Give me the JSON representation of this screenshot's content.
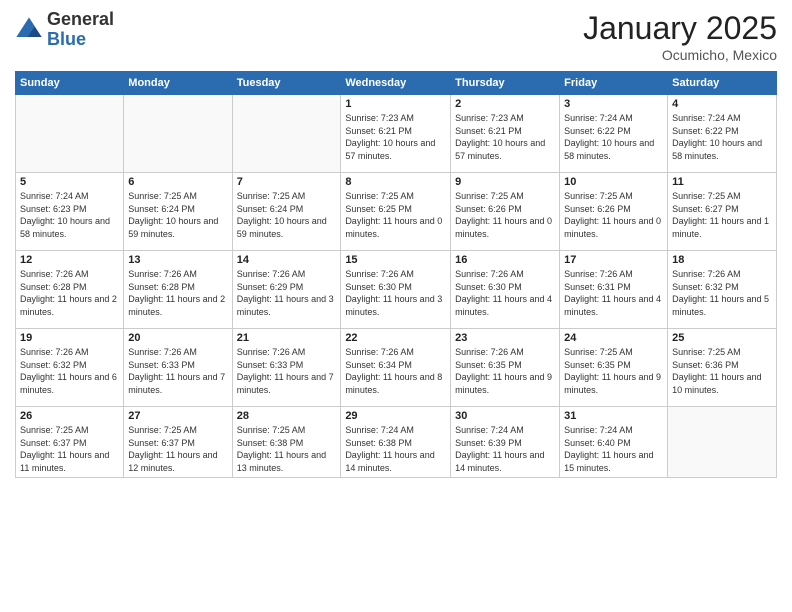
{
  "header": {
    "logo_general": "General",
    "logo_blue": "Blue",
    "month_title": "January 2025",
    "subtitle": "Ocumicho, Mexico"
  },
  "days_of_week": [
    "Sunday",
    "Monday",
    "Tuesday",
    "Wednesday",
    "Thursday",
    "Friday",
    "Saturday"
  ],
  "weeks": [
    [
      {
        "day": "",
        "info": ""
      },
      {
        "day": "",
        "info": ""
      },
      {
        "day": "",
        "info": ""
      },
      {
        "day": "1",
        "info": "Sunrise: 7:23 AM\nSunset: 6:21 PM\nDaylight: 10 hours and 57 minutes."
      },
      {
        "day": "2",
        "info": "Sunrise: 7:23 AM\nSunset: 6:21 PM\nDaylight: 10 hours and 57 minutes."
      },
      {
        "day": "3",
        "info": "Sunrise: 7:24 AM\nSunset: 6:22 PM\nDaylight: 10 hours and 58 minutes."
      },
      {
        "day": "4",
        "info": "Sunrise: 7:24 AM\nSunset: 6:22 PM\nDaylight: 10 hours and 58 minutes."
      }
    ],
    [
      {
        "day": "5",
        "info": "Sunrise: 7:24 AM\nSunset: 6:23 PM\nDaylight: 10 hours and 58 minutes."
      },
      {
        "day": "6",
        "info": "Sunrise: 7:25 AM\nSunset: 6:24 PM\nDaylight: 10 hours and 59 minutes."
      },
      {
        "day": "7",
        "info": "Sunrise: 7:25 AM\nSunset: 6:24 PM\nDaylight: 10 hours and 59 minutes."
      },
      {
        "day": "8",
        "info": "Sunrise: 7:25 AM\nSunset: 6:25 PM\nDaylight: 11 hours and 0 minutes."
      },
      {
        "day": "9",
        "info": "Sunrise: 7:25 AM\nSunset: 6:26 PM\nDaylight: 11 hours and 0 minutes."
      },
      {
        "day": "10",
        "info": "Sunrise: 7:25 AM\nSunset: 6:26 PM\nDaylight: 11 hours and 0 minutes."
      },
      {
        "day": "11",
        "info": "Sunrise: 7:25 AM\nSunset: 6:27 PM\nDaylight: 11 hours and 1 minute."
      }
    ],
    [
      {
        "day": "12",
        "info": "Sunrise: 7:26 AM\nSunset: 6:28 PM\nDaylight: 11 hours and 2 minutes."
      },
      {
        "day": "13",
        "info": "Sunrise: 7:26 AM\nSunset: 6:28 PM\nDaylight: 11 hours and 2 minutes."
      },
      {
        "day": "14",
        "info": "Sunrise: 7:26 AM\nSunset: 6:29 PM\nDaylight: 11 hours and 3 minutes."
      },
      {
        "day": "15",
        "info": "Sunrise: 7:26 AM\nSunset: 6:30 PM\nDaylight: 11 hours and 3 minutes."
      },
      {
        "day": "16",
        "info": "Sunrise: 7:26 AM\nSunset: 6:30 PM\nDaylight: 11 hours and 4 minutes."
      },
      {
        "day": "17",
        "info": "Sunrise: 7:26 AM\nSunset: 6:31 PM\nDaylight: 11 hours and 4 minutes."
      },
      {
        "day": "18",
        "info": "Sunrise: 7:26 AM\nSunset: 6:32 PM\nDaylight: 11 hours and 5 minutes."
      }
    ],
    [
      {
        "day": "19",
        "info": "Sunrise: 7:26 AM\nSunset: 6:32 PM\nDaylight: 11 hours and 6 minutes."
      },
      {
        "day": "20",
        "info": "Sunrise: 7:26 AM\nSunset: 6:33 PM\nDaylight: 11 hours and 7 minutes."
      },
      {
        "day": "21",
        "info": "Sunrise: 7:26 AM\nSunset: 6:33 PM\nDaylight: 11 hours and 7 minutes."
      },
      {
        "day": "22",
        "info": "Sunrise: 7:26 AM\nSunset: 6:34 PM\nDaylight: 11 hours and 8 minutes."
      },
      {
        "day": "23",
        "info": "Sunrise: 7:26 AM\nSunset: 6:35 PM\nDaylight: 11 hours and 9 minutes."
      },
      {
        "day": "24",
        "info": "Sunrise: 7:25 AM\nSunset: 6:35 PM\nDaylight: 11 hours and 9 minutes."
      },
      {
        "day": "25",
        "info": "Sunrise: 7:25 AM\nSunset: 6:36 PM\nDaylight: 11 hours and 10 minutes."
      }
    ],
    [
      {
        "day": "26",
        "info": "Sunrise: 7:25 AM\nSunset: 6:37 PM\nDaylight: 11 hours and 11 minutes."
      },
      {
        "day": "27",
        "info": "Sunrise: 7:25 AM\nSunset: 6:37 PM\nDaylight: 11 hours and 12 minutes."
      },
      {
        "day": "28",
        "info": "Sunrise: 7:25 AM\nSunset: 6:38 PM\nDaylight: 11 hours and 13 minutes."
      },
      {
        "day": "29",
        "info": "Sunrise: 7:24 AM\nSunset: 6:38 PM\nDaylight: 11 hours and 14 minutes."
      },
      {
        "day": "30",
        "info": "Sunrise: 7:24 AM\nSunset: 6:39 PM\nDaylight: 11 hours and 14 minutes."
      },
      {
        "day": "31",
        "info": "Sunrise: 7:24 AM\nSunset: 6:40 PM\nDaylight: 11 hours and 15 minutes."
      },
      {
        "day": "",
        "info": ""
      }
    ]
  ]
}
